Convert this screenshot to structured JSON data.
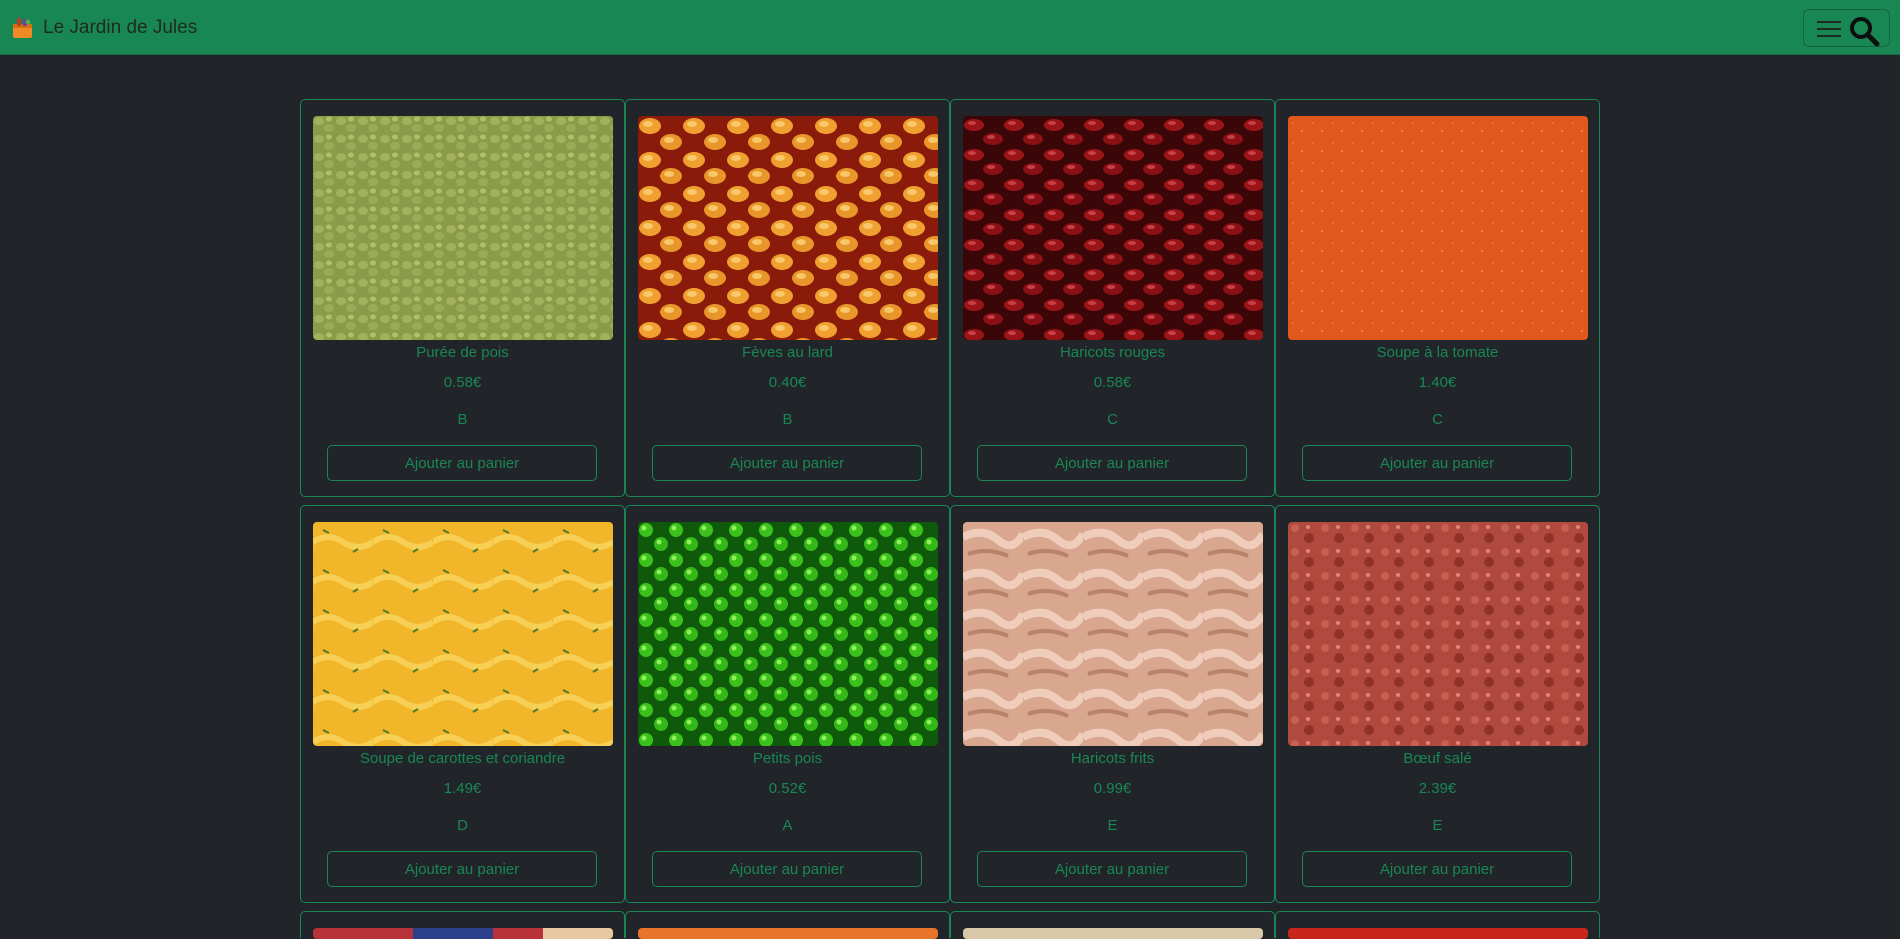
{
  "navbar": {
    "brand": "Le Jardin de Jules",
    "logo_icon": "shopping-bag-icon",
    "menu_icon": "hamburger-menu-icon",
    "search_icon": "search-icon"
  },
  "colors": {
    "navbar": "#198754",
    "background": "#212529",
    "accent": "#198754"
  },
  "products": [
    {
      "name": "Purée de pois",
      "price": "0.58€",
      "score": "B",
      "button": "Ajouter au panier"
    },
    {
      "name": "Fèves au lard",
      "price": "0.40€",
      "score": "B",
      "button": "Ajouter au panier"
    },
    {
      "name": "Haricots rouges",
      "price": "0.58€",
      "score": "C",
      "button": "Ajouter au panier"
    },
    {
      "name": "Soupe à la tomate",
      "price": "1.40€",
      "score": "C",
      "button": "Ajouter au panier"
    },
    {
      "name": "Soupe de carottes et coriandre",
      "price": "1.49€",
      "score": "D",
      "button": "Ajouter au panier"
    },
    {
      "name": "Petits pois",
      "price": "0.52€",
      "score": "A",
      "button": "Ajouter au panier"
    },
    {
      "name": "Haricots frits",
      "price": "0.99€",
      "score": "E",
      "button": "Ajouter au panier"
    },
    {
      "name": "Bœuf salé",
      "price": "2.39€",
      "score": "E",
      "button": "Ajouter au panier"
    }
  ]
}
